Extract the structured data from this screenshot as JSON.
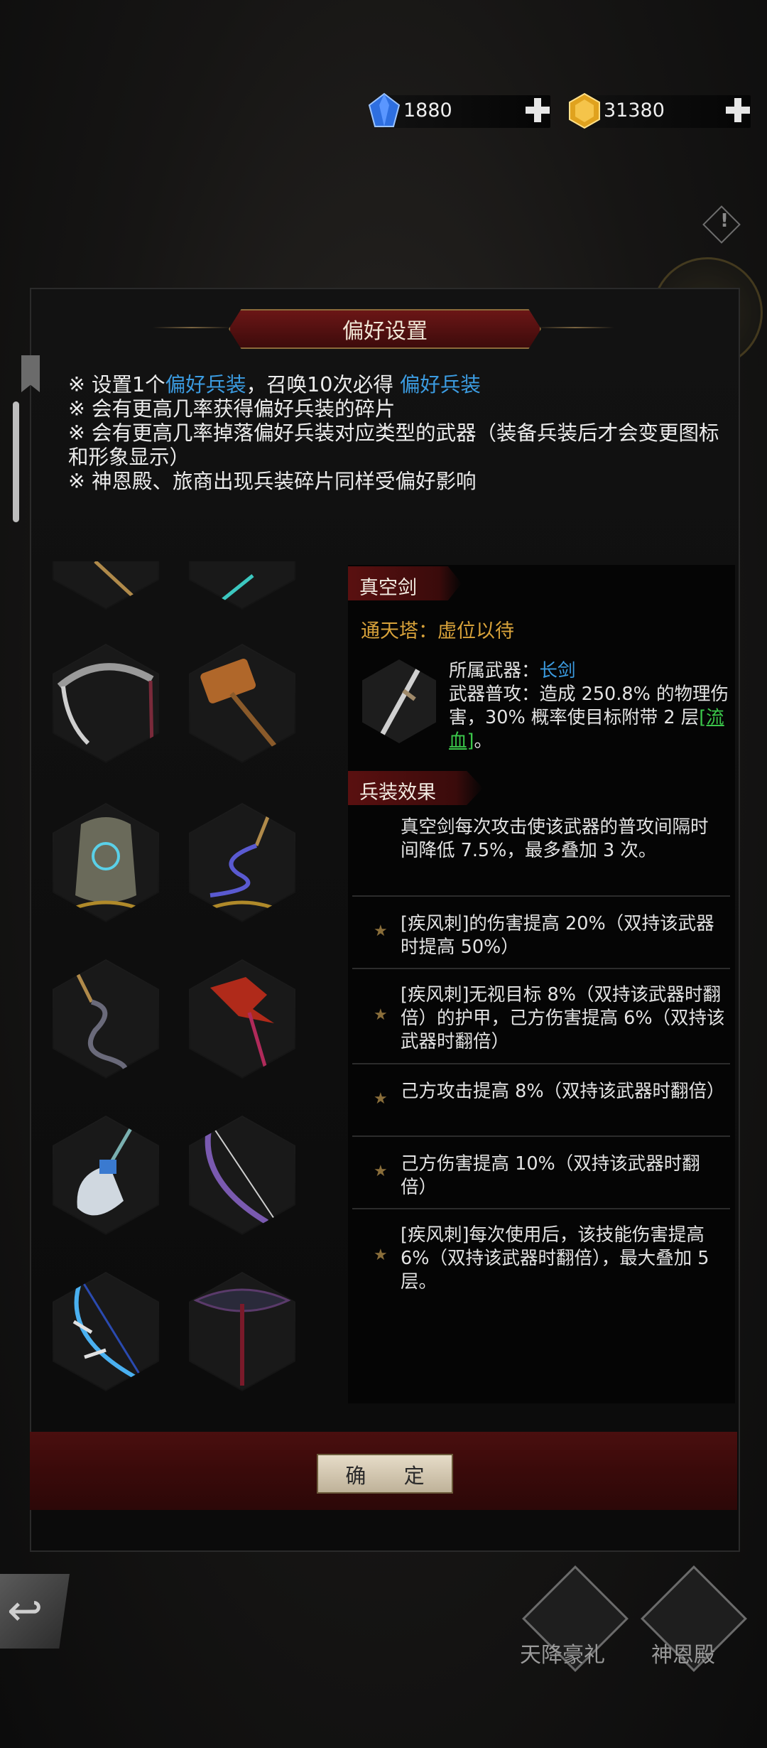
{
  "currencies": [
    {
      "icon": "blue-gem-icon",
      "value": "1880"
    },
    {
      "icon": "gold-gem-icon",
      "value": "31380"
    }
  ],
  "dialog": {
    "title": "偏好设置",
    "notes": [
      {
        "pre": "※ 设置1个",
        "hl1": "偏好兵装",
        "mid": "，召唤10次必得 ",
        "hl2": "偏好兵装"
      },
      {
        "text": "※ 会有更高几率获得偏好兵装的碎片"
      },
      {
        "text": "※ 会有更高几率掉落偏好兵装对应类型的武器（装备兵装后才会变更图标和形象显示）"
      },
      {
        "text": "※ 神恩殿、旅商出现兵装碎片同样受偏好影响"
      }
    ],
    "weapons": [
      {
        "icon": "weapon-icon"
      },
      {
        "icon": "spear-icon"
      },
      {
        "icon": "scythe-icon"
      },
      {
        "icon": "hammer-icon"
      },
      {
        "icon": "shield-rune-icon"
      },
      {
        "icon": "chain-staff-icon"
      },
      {
        "icon": "whip-icon"
      },
      {
        "icon": "dragon-staff-icon"
      },
      {
        "icon": "crystal-axe-icon"
      },
      {
        "icon": "purple-bow-icon"
      },
      {
        "icon": "frost-bow-icon"
      },
      {
        "icon": "dark-halberd-icon"
      }
    ],
    "detail": {
      "name": "真空剑",
      "tower_label": "通天塔：",
      "tower_value": "虚位以待",
      "weapon_type_label": "所属武器：",
      "weapon_type_value": "长剑",
      "attack_pre": "武器普攻：造成 250.8% 的物理伤害，30% 概率使目标附带 2 层",
      "attack_link": "[流血]",
      "attack_post": "。",
      "effects_title": "兵装效果",
      "effects": [
        {
          "text": "真空剑每次攻击使该武器的普攻间隔时间降低 7.5%，最多叠加 3 次。",
          "star": false
        },
        {
          "text": "[疾风刺]的伤害提高 20%（双持该武器时提高 50%）",
          "star": true
        },
        {
          "text": "[疾风刺]无视目标 8%（双持该武器时翻倍）的护甲，己方伤害提高 6%（双持该武器时翻倍）",
          "star": true
        },
        {
          "text": "己方攻击提高 8%（双持该武器时翻倍）",
          "star": true
        },
        {
          "text": "己方伤害提高 10%（双持该武器时翻倍）",
          "star": true
        },
        {
          "text": "[疾风刺]每次使用后，该技能伤害提高 6%（双持该武器时翻倍），最大叠加 5 层。",
          "star": true
        }
      ]
    },
    "confirm_label": "确 定"
  },
  "nav": [
    {
      "label": "天降豪礼",
      "icon": "gift-icon"
    },
    {
      "label": "神恩殿",
      "icon": "temple-icon"
    }
  ]
}
